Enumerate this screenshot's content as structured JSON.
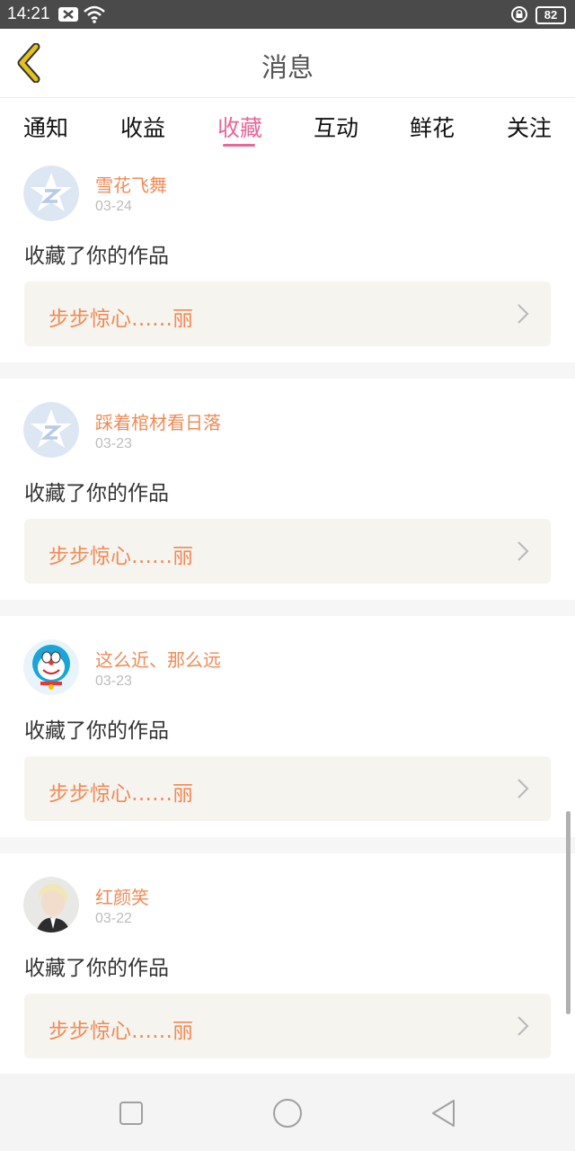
{
  "status": {
    "time": "14:21",
    "battery": "82"
  },
  "header": {
    "title": "消息"
  },
  "tabs": [
    {
      "label": "通知"
    },
    {
      "label": "收益"
    },
    {
      "label": "收藏",
      "active": true
    },
    {
      "label": "互动"
    },
    {
      "label": "鲜花"
    },
    {
      "label": "关注"
    }
  ],
  "feed": [
    {
      "name": "雪花飞舞",
      "date": "03-24",
      "action": "收藏了你的作品",
      "work": "步步惊心……丽",
      "avatar": "qq-default-avatar"
    },
    {
      "name": "踩着棺材看日落",
      "date": "03-23",
      "action": "收藏了你的作品",
      "work": "步步惊心……丽",
      "avatar": "qq-default-avatar"
    },
    {
      "name": "这么近、那么远",
      "date": "03-23",
      "action": "收藏了你的作品",
      "work": "步步惊心……丽",
      "avatar": "doraemon-avatar"
    },
    {
      "name": "红颜笑",
      "date": "03-22",
      "action": "收藏了你的作品",
      "work": "步步惊心……丽",
      "avatar": "portrait-avatar"
    }
  ],
  "colors": {
    "accent": "#e8669a",
    "orange": "#ef8b57",
    "back": "#e5c21a"
  },
  "icons": {
    "back": "chevron-left-icon",
    "recents": "square-icon",
    "home": "circle-icon",
    "nav_back": "triangle-back-icon"
  }
}
